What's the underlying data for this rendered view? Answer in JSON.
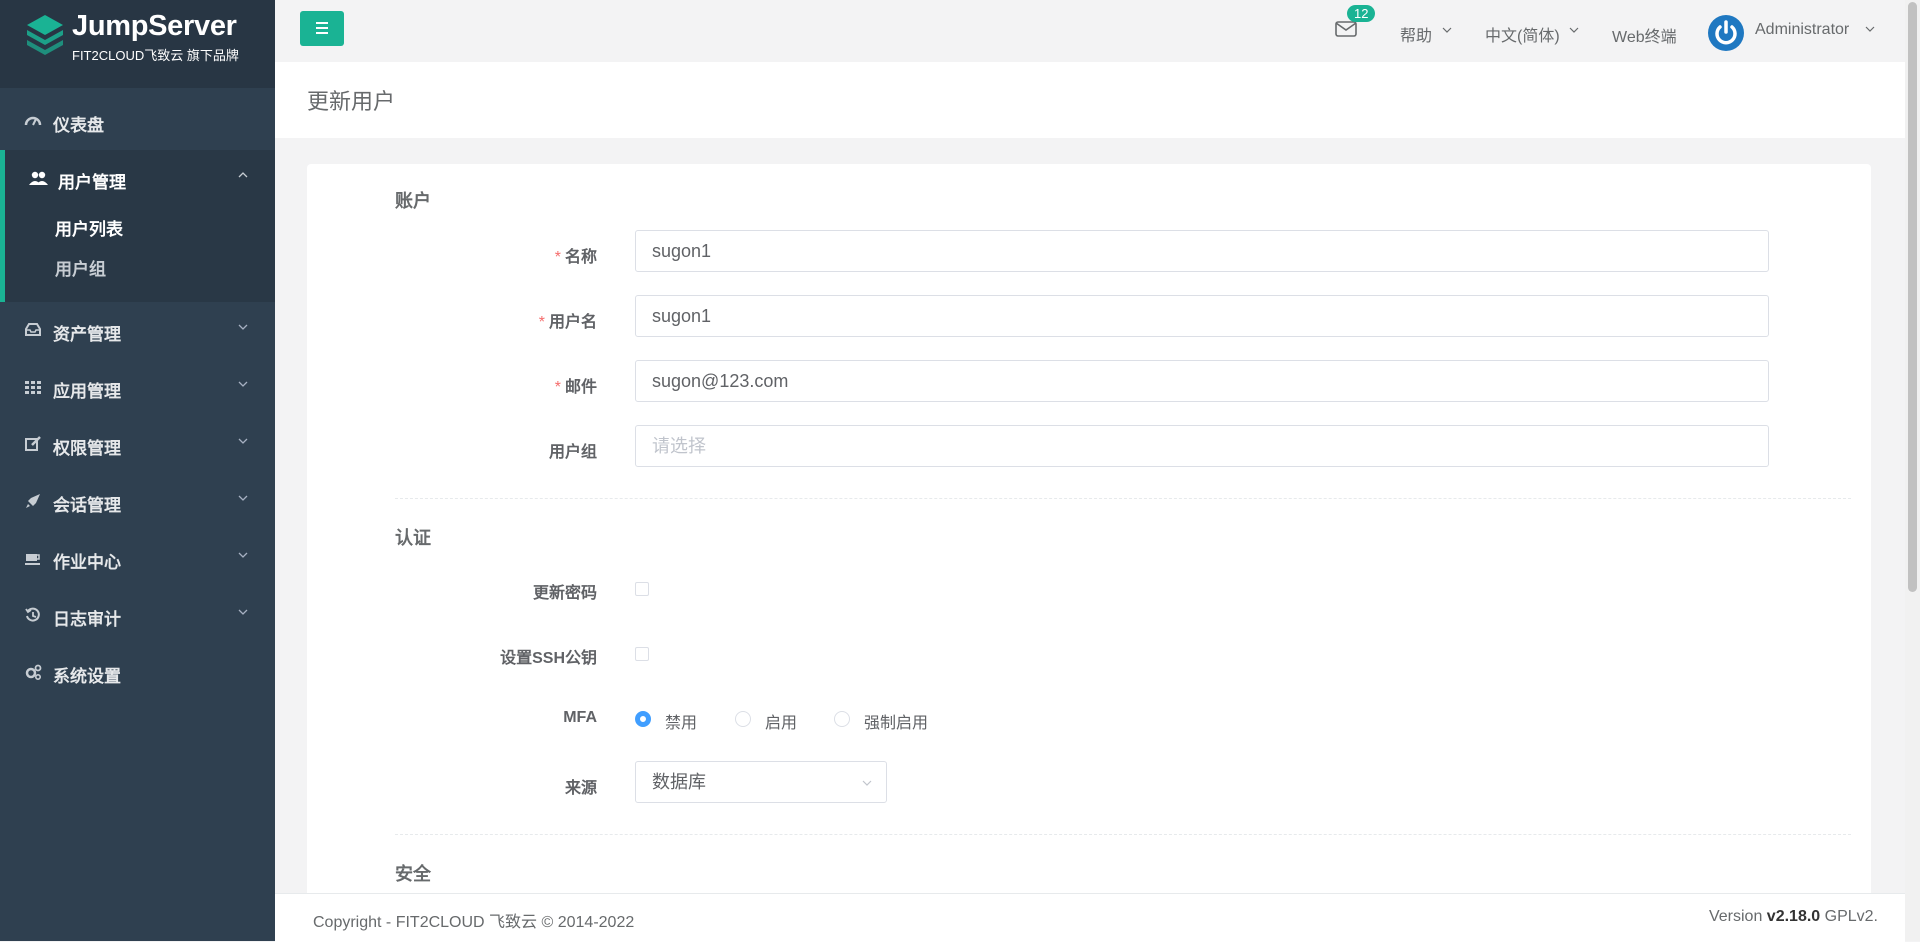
{
  "brand": {
    "title": "JumpServer",
    "subtitle": "FIT2CLOUD飞致云 旗下品牌"
  },
  "sidebar": {
    "dashboard": "仪表盘",
    "users": {
      "label": "用户管理",
      "sub": [
        "用户列表",
        "用户组"
      ]
    },
    "items": [
      "资产管理",
      "应用管理",
      "权限管理",
      "会话管理",
      "作业中心",
      "日志审计"
    ],
    "settings": "系统设置"
  },
  "topbar": {
    "mail_count": "12",
    "help": "帮助",
    "language": "中文(简体)",
    "web_terminal": "Web终端",
    "user": "Administrator"
  },
  "page": {
    "title": "更新用户"
  },
  "form": {
    "account": {
      "title": "账户",
      "name_label": "名称",
      "name_value": "sugon1",
      "username_label": "用户名",
      "username_value": "sugon1",
      "email_label": "邮件",
      "email_value": "sugon@123.com",
      "groups_label": "用户组",
      "groups_placeholder": "请选择"
    },
    "auth": {
      "title": "认证",
      "update_password_label": "更新密码",
      "ssh_key_label": "设置SSH公钥",
      "mfa_label": "MFA",
      "mfa_options": [
        "禁用",
        "启用",
        "强制启用"
      ],
      "mfa_selected": "禁用",
      "source_label": "来源",
      "source_value": "数据库"
    },
    "security": {
      "title": "安全"
    }
  },
  "footer": {
    "copyright": "Copyright - FIT2CLOUD 飞致云 © 2014-2022",
    "version_prefix": "Version ",
    "version": "v2.18.0",
    "license": " GPLv2."
  },
  "colors": {
    "sidebar_bg": "#2f4050",
    "accent": "#1ab394",
    "radio_active": "#409eff",
    "required": "#f56c6c"
  }
}
